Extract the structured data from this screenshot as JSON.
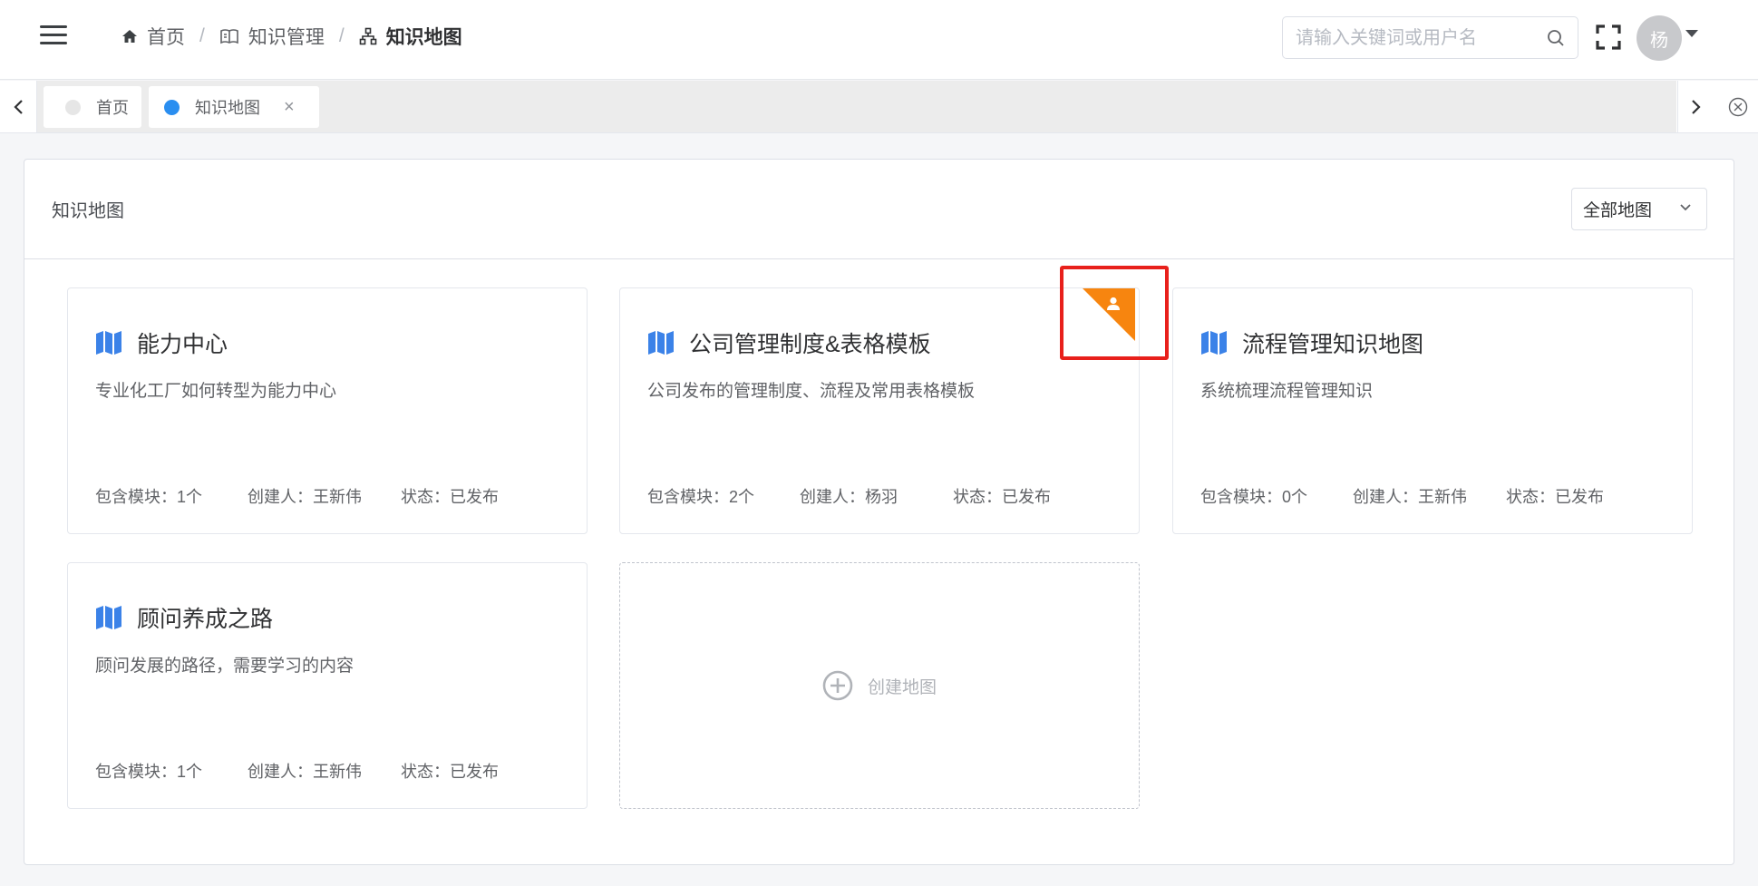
{
  "header": {
    "breadcrumb": [
      {
        "label": "首页",
        "icon": "home-icon"
      },
      {
        "label": "知识管理",
        "icon": "book-icon"
      },
      {
        "label": "知识地图",
        "icon": "sitemap-icon"
      }
    ],
    "separator": "/",
    "search_placeholder": "请输入关键词或用户名",
    "avatar_text": "杨"
  },
  "tabs": [
    {
      "label": "首页",
      "dot_color": "#e6e6e6",
      "active": false
    },
    {
      "label": "知识地图",
      "dot_color": "#2a8ef0",
      "active": true,
      "close": "×"
    }
  ],
  "panel": {
    "title": "知识地图",
    "filter_value": "全部地图"
  },
  "cards": [
    {
      "title": "能力中心",
      "desc": "专业化工厂如何转型为能力中心",
      "modules": "包含模块：1个",
      "creator": "创建人：王新伟",
      "status": "状态：已发布",
      "mine": false
    },
    {
      "title": "公司管理制度&表格模板",
      "desc": "公司发布的管理制度、流程及常用表格模板",
      "modules": "包含模块：2个",
      "creator": "创建人：杨羽",
      "status": "状态：已发布",
      "mine": true
    },
    {
      "title": "流程管理知识地图",
      "desc": "系统梳理流程管理知识",
      "modules": "包含模块：0个",
      "creator": "创建人：王新伟",
      "status": "状态：已发布",
      "mine": false
    },
    {
      "title": "顾问养成之路",
      "desc": "顾问发展的路径，需要学习的内容",
      "modules": "包含模块：1个",
      "creator": "创建人：王新伟",
      "status": "状态：已发布",
      "mine": false
    }
  ],
  "create_label": "创建地图",
  "colors": {
    "accent": "#2a8ef0",
    "ribbon": "#f7850f",
    "highlight": "#e8201b",
    "map_icon": "#3b82e8"
  }
}
